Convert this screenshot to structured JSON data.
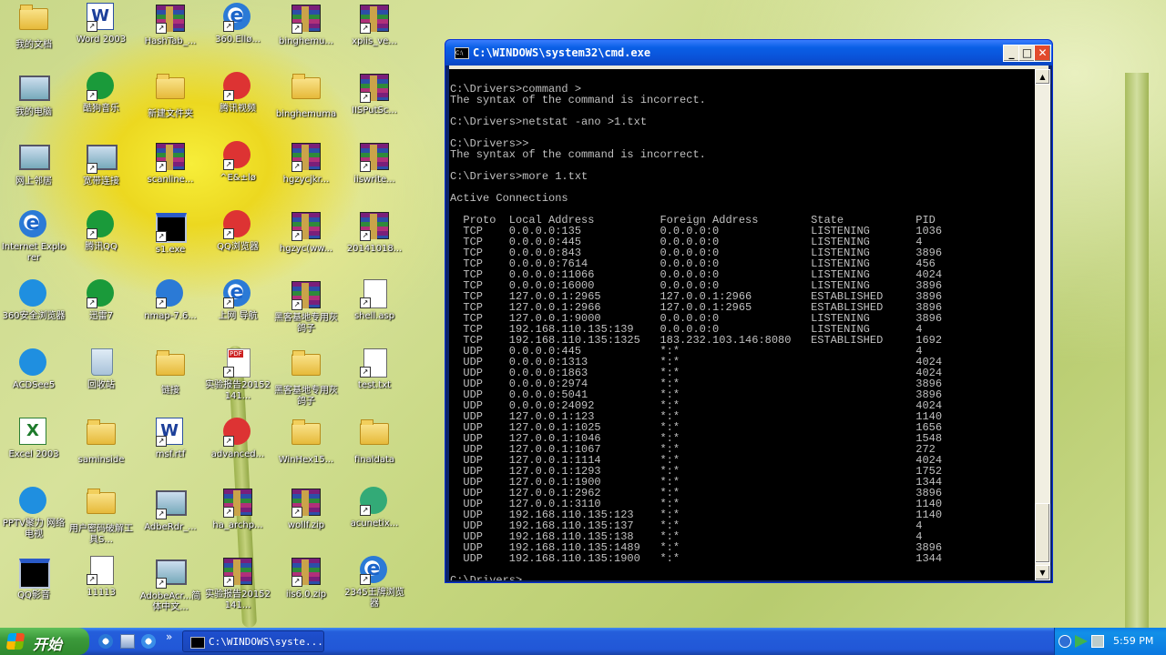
{
  "desktop": {
    "icons": [
      {
        "label": "我的文档"
      },
      {
        "label": "Word 2003"
      },
      {
        "label": "HashTab_..."
      },
      {
        "label": "360.Ellø..."
      },
      {
        "label": "binghemu..."
      },
      {
        "label": "xpiis_ve..."
      },
      {
        "label": "我的电脑"
      },
      {
        "label": "酷狗音乐"
      },
      {
        "label": "新建文件夹"
      },
      {
        "label": "腾讯视频"
      },
      {
        "label": "binghemuma"
      },
      {
        "label": "IISPutSc..."
      },
      {
        "label": "网上邻居"
      },
      {
        "label": "宽带连接"
      },
      {
        "label": "scanline..."
      },
      {
        "label": "^E&±lø"
      },
      {
        "label": "hgzycjkr..."
      },
      {
        "label": "iiswrite..."
      },
      {
        "label": "Internet Explorer"
      },
      {
        "label": "腾讯QQ"
      },
      {
        "label": "s1.exe"
      },
      {
        "label": "QQ浏览器"
      },
      {
        "label": "hgzyc(ww..."
      },
      {
        "label": "20141018..."
      },
      {
        "label": "360安全浏览器"
      },
      {
        "label": "迅雷7"
      },
      {
        "label": "nmap-7.6..."
      },
      {
        "label": "上网 导航"
      },
      {
        "label": "黑客基地专用灰鸽子"
      },
      {
        "label": "shell.asp"
      },
      {
        "label": "ACDSee5"
      },
      {
        "label": "回收站"
      },
      {
        "label": "链接"
      },
      {
        "label": "实验报告20152141..."
      },
      {
        "label": "黑客基地专用灰鸽子"
      },
      {
        "label": "test.txt"
      },
      {
        "label": "Excel 2003"
      },
      {
        "label": "saminside"
      },
      {
        "label": "msf.rtf"
      },
      {
        "label": "advanced..."
      },
      {
        "label": "WinHex15..."
      },
      {
        "label": "finaldata"
      },
      {
        "label": "PPTV聚力 网络电视"
      },
      {
        "label": "用户密码破解工具S..."
      },
      {
        "label": "AdbeRdr_..."
      },
      {
        "label": "ha_archp..."
      },
      {
        "label": "wollf.zip"
      },
      {
        "label": "acunetix..."
      },
      {
        "label": "QQ影音"
      },
      {
        "label": "11113"
      },
      {
        "label": "AdobeAcr...简体中文..."
      },
      {
        "label": "实验报告20152141..."
      },
      {
        "label": "iis6.0.zip"
      },
      {
        "label": "2345王牌浏览器"
      }
    ]
  },
  "cmd_window": {
    "title": "C:\\WINDOWS\\system32\\cmd.exe",
    "min_glyph": "_",
    "max_glyph": "□",
    "close_glyph": "✕",
    "icon_text": "C:\\",
    "console_text": "C:\\Drivers>command >\nThe syntax of the command is incorrect.\n\nC:\\Drivers>netstat -ano >1.txt\n\nC:\\Drivers>>\nThe syntax of the command is incorrect.\n\nC:\\Drivers>more 1.txt\n\nActive Connections\n\n  Proto  Local Address          Foreign Address        State           PID\n  TCP    0.0.0.0:135            0.0.0.0:0              LISTENING       1036\n  TCP    0.0.0.0:445            0.0.0.0:0              LISTENING       4\n  TCP    0.0.0.0:843            0.0.0.0:0              LISTENING       3896\n  TCP    0.0.0.0:7614           0.0.0.0:0              LISTENING       456\n  TCP    0.0.0.0:11066          0.0.0.0:0              LISTENING       4024\n  TCP    0.0.0.0:16000          0.0.0.0:0              LISTENING       3896\n  TCP    127.0.0.1:2965         127.0.0.1:2966         ESTABLISHED     3896\n  TCP    127.0.0.1:2966         127.0.0.1:2965         ESTABLISHED     3896\n  TCP    127.0.0.1:9000         0.0.0.0:0              LISTENING       3896\n  TCP    192.168.110.135:139    0.0.0.0:0              LISTENING       4\n  TCP    192.168.110.135:1325   183.232.103.146:8080   ESTABLISHED     1692\n  UDP    0.0.0.0:445            *:*                                    4\n  UDP    0.0.0.0:1313           *:*                                    4024\n  UDP    0.0.0.0:1863           *:*                                    4024\n  UDP    0.0.0.0:2974           *:*                                    3896\n  UDP    0.0.0.0:5041           *:*                                    3896\n  UDP    0.0.0.0:24092          *:*                                    4024\n  UDP    127.0.0.1:123          *:*                                    1140\n  UDP    127.0.0.1:1025         *:*                                    1656\n  UDP    127.0.0.1:1046         *:*                                    1548\n  UDP    127.0.0.1:1067         *:*                                    272\n  UDP    127.0.0.1:1114         *:*                                    4024\n  UDP    127.0.0.1:1293         *:*                                    1752\n  UDP    127.0.0.1:1900         *:*                                    1344\n  UDP    127.0.0.1:2962         *:*                                    3896\n  UDP    127.0.0.1:3110         *:*                                    1140\n  UDP    192.168.110.135:123    *:*                                    1140\n  UDP    192.168.110.135:137    *:*                                    4\n  UDP    192.168.110.135:138    *:*                                    4\n  UDP    192.168.110.135:1489   *:*                                    3896\n  UDP    192.168.110.135:1900   *:*                                    1344\n\nC:\\Drivers>",
    "scroll_up": "▲",
    "scroll_down": "▼"
  },
  "taskbar": {
    "start_label": "开始",
    "task_label": "C:\\WINDOWS\\syste...",
    "chevron": "»",
    "clock": "5:59 PM"
  }
}
